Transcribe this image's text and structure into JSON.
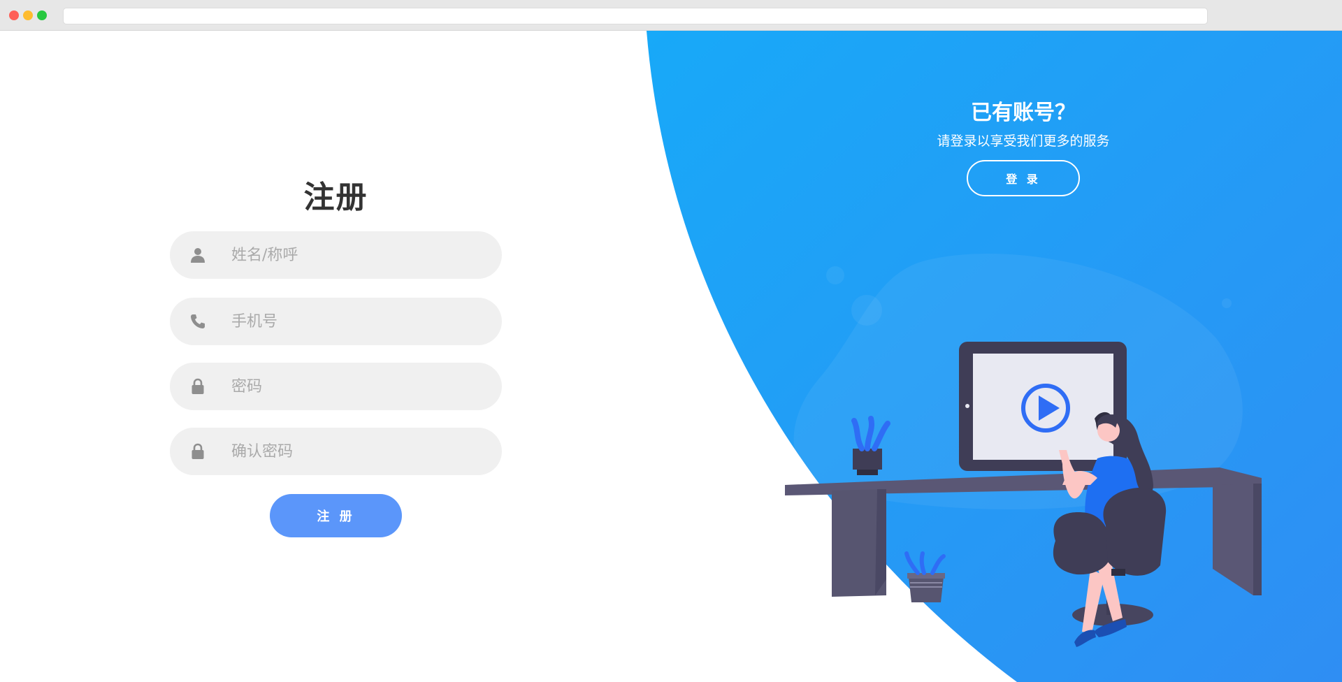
{
  "form": {
    "title": "注册",
    "fields": [
      {
        "placeholder": "姓名/称呼",
        "icon": "user-icon"
      },
      {
        "placeholder": "手机号",
        "icon": "phone-icon"
      },
      {
        "placeholder": "密码",
        "icon": "lock-icon"
      },
      {
        "placeholder": "确认密码",
        "icon": "lock-icon"
      }
    ],
    "submit_label": "注 册"
  },
  "panel": {
    "title": "已有账号？",
    "subtitle": "请登录以享受我们更多的服务",
    "login_label": "登 录"
  },
  "colors": {
    "accent": "#5b96fa",
    "panel_blue_top": "#18a9f8",
    "panel_blue_bottom": "#2f8ef3",
    "field_bg": "#f0f0f0"
  }
}
